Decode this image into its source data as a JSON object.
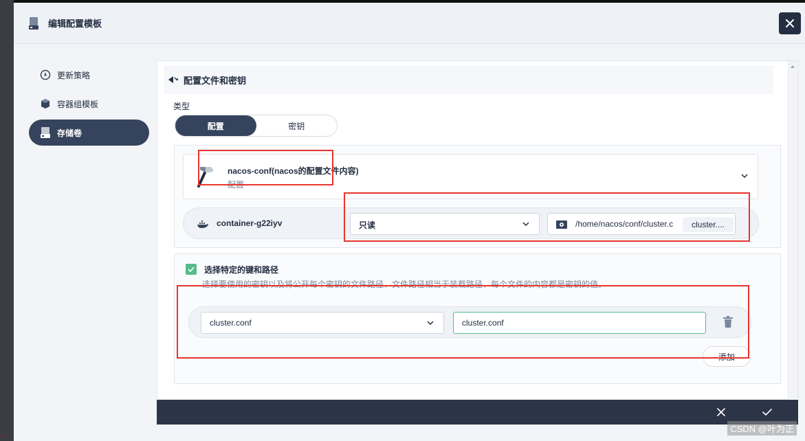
{
  "header": {
    "title": "编辑配置模板"
  },
  "nav": {
    "items": [
      {
        "label": "更新策略",
        "icon": "update-strategy-icon"
      },
      {
        "label": "容器组模板",
        "icon": "pod-template-icon"
      },
      {
        "label": "存储卷",
        "icon": "storage-volume-icon",
        "active": true
      }
    ]
  },
  "section": {
    "title": "配置文件和密钥"
  },
  "type": {
    "label": "类型",
    "options": [
      "配置",
      "密钥"
    ],
    "selected": "配置"
  },
  "config": {
    "name": "nacos-conf(nacos的配置文件内容)",
    "kind": "配置"
  },
  "mount": {
    "container": "container-g22iyv",
    "mode": "只读",
    "path": "/home/nacos/conf/cluster.c",
    "subpath": "cluster...."
  },
  "keys": {
    "checked": true,
    "label": "选择特定的键和路径",
    "description": "选择要使用的密钥以及将公开每个密钥的文件路径，文件路径相当于装载路径，每个文件的内容都是密钥的值。",
    "rows": [
      {
        "key": "cluster.conf",
        "path": "cluster.conf"
      }
    ],
    "add_label": "添加"
  },
  "watermark": "CSDN @叶为正",
  "colors": {
    "primary_dark": "#36435c",
    "accent_green": "#55bc8a",
    "annotation_red": "#e8342e"
  }
}
